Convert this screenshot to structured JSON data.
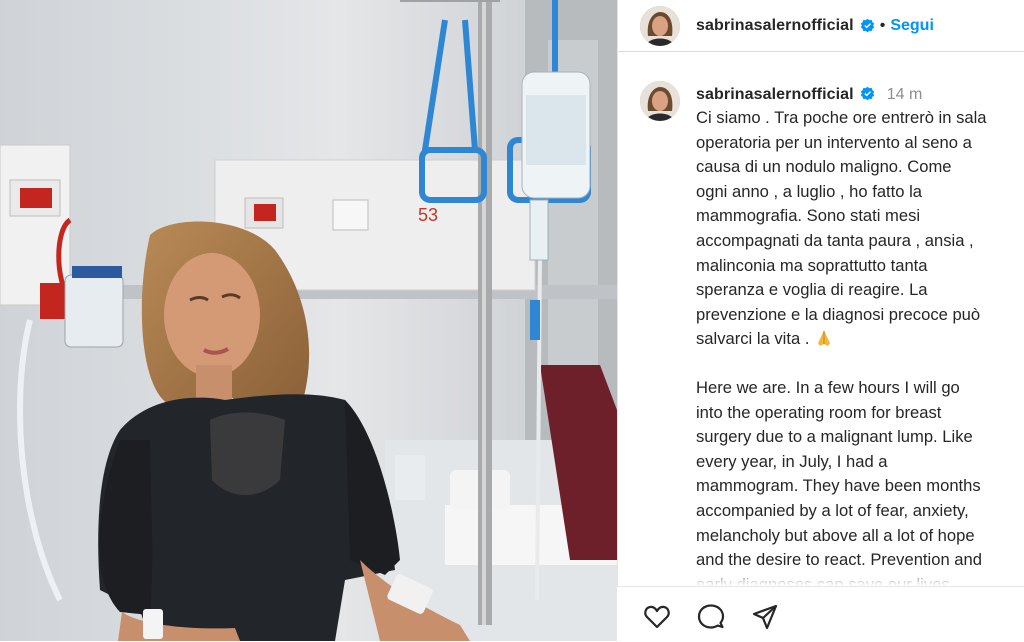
{
  "post": {
    "username": "sabrinasalernofficial",
    "follow_separator": "•",
    "follow_label": "Segui",
    "time_ago": "14 m",
    "caption_it": "Ci siamo . Tra poche ore entrerò in sala\noperatoria per un intervento al seno a\ncausa di un nodulo maligno. Come\nogni anno , a luglio , ho fatto la\nmammografia. Sono stati mesi\naccompagnati da tanta paura , ansia ,\nmalinconia ma soprattutto tanta\nsperanza e voglia di reagire. La\nprevenzione e la diagnosi precoce può\nsalvarci la vita . ",
    "caption_en": "Here we are. In a few hours I will go\ninto the operating room for breast\nsurgery due to a malignant lump. Like\nevery year, in July, I had a\nmammogram. They have been months\naccompanied by a lot of fear, anxiety,\nmelancholy but above all a lot of hope\nand the desire to react. Prevention and\nearly diagnoses can save our lives."
  },
  "room": {
    "number": "53"
  },
  "icons": {
    "verified": "verified-badge-icon",
    "prayer": "folded-hands-emoji",
    "like": "heart-icon",
    "comment": "comment-bubble-icon",
    "share": "paper-plane-icon"
  },
  "colors": {
    "accent": "#0095f6",
    "text": "#262626",
    "muted": "#8e8e8e"
  }
}
